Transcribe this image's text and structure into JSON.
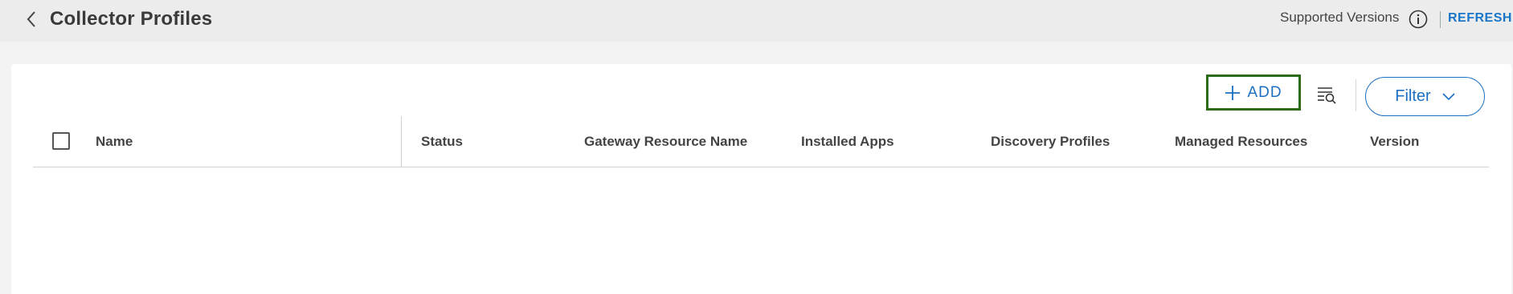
{
  "header": {
    "title": "Collector Profiles",
    "supported_versions_label": "Supported Versions",
    "refresh_label": "REFRESH"
  },
  "toolbar": {
    "add_label": "ADD",
    "filter_label": "Filter"
  },
  "table": {
    "columns": [
      "Name",
      "Status",
      "Gateway Resource Name",
      "Installed Apps",
      "Discovery Profiles",
      "Managed Resources",
      "Version"
    ],
    "rows": []
  },
  "colors": {
    "accent": "#1b6fc2",
    "add_highlight_border": "#2d6a14",
    "topbar_bg": "#ececec",
    "page_bg": "#f3f3f3"
  },
  "icons": {
    "back": "chevron-left-icon",
    "info": "info-circle-icon",
    "add": "plus-icon",
    "search_list": "list-search-icon",
    "filter": "chevron-down-icon"
  }
}
